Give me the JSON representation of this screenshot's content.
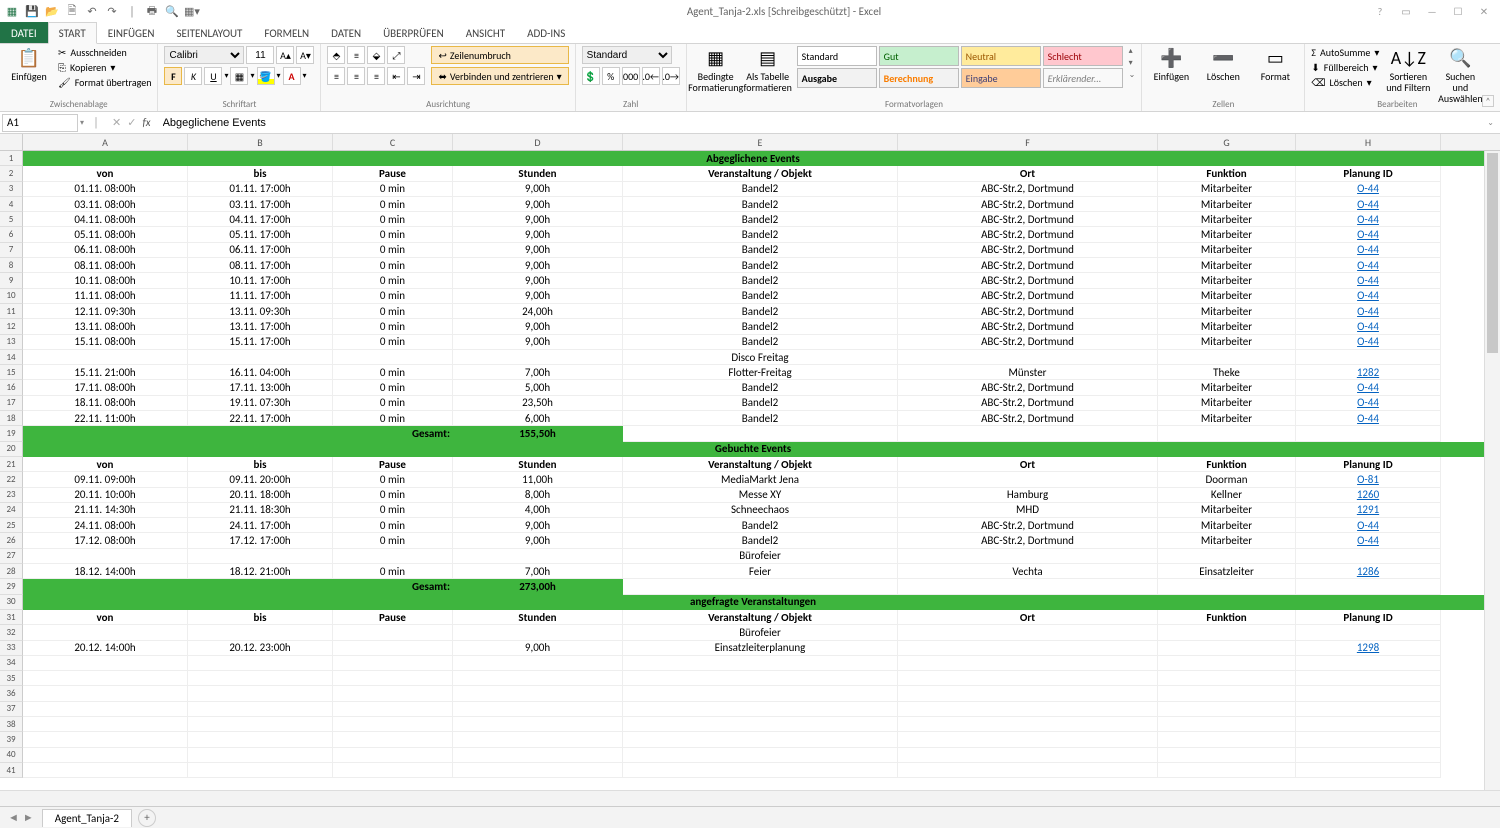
{
  "window": {
    "title": "Agent_Tanja-2.xls  [Schreibgeschützt] - Excel"
  },
  "qat": [
    "💾",
    "📂",
    "📄",
    "↶",
    "↷",
    "|",
    "🖨",
    "🔍",
    "⚙"
  ],
  "winbtns": {
    "help": "?",
    "opts": "▭",
    "min": "—",
    "max": "☐",
    "close": "✕"
  },
  "tabs": {
    "file": "DATEI",
    "start": "START",
    "einf": "EINFÜGEN",
    "layout": "SEITENLAYOUT",
    "form": "FORMELN",
    "daten": "DATEN",
    "ueber": "ÜBERPRÜFEN",
    "ans": "ANSICHT",
    "add": "ADD-INS"
  },
  "ribbon": {
    "clipboard": {
      "label": "Zwischenablage",
      "paste": "Einfügen",
      "cut": "Ausschneiden",
      "copy": "Kopieren",
      "format": "Format übertragen"
    },
    "font": {
      "label": "Schriftart",
      "name": "Calibri",
      "size": "11"
    },
    "align": {
      "label": "Ausrichtung",
      "wrap": "Zeilenumbruch",
      "merge": "Verbinden und zentrieren"
    },
    "number": {
      "label": "Zahl",
      "format": "Standard"
    },
    "styles": {
      "label": "Formatvorlagen",
      "cond": "Bedingte Formatierung",
      "table": "Als Tabelle formatieren",
      "standard": "Standard",
      "gut": "Gut",
      "neutral": "Neutral",
      "schlecht": "Schlecht",
      "ausgabe": "Ausgabe",
      "berechnung": "Berechnung",
      "eingabe": "Eingabe",
      "erkl": "Erklärender..."
    },
    "cells": {
      "label": "Zellen",
      "ins": "Einfügen",
      "del": "Löschen",
      "fmt": "Format"
    },
    "edit": {
      "label": "Bearbeiten",
      "sum": "AutoSumme",
      "fill": "Füllbereich",
      "clear": "Löschen",
      "sort": "Sortieren und Filtern",
      "find": "Suchen und Auswählen"
    }
  },
  "formulabar": {
    "cellref": "A1",
    "formula": "Abgeglichene Events"
  },
  "columns": [
    "A",
    "B",
    "C",
    "D",
    "E",
    "F",
    "G",
    "H"
  ],
  "sheet": {
    "tabname": "Agent_Tanja-2",
    "sections": [
      {
        "title": "Abgeglichene Events",
        "rows": [
          [
            "01.11. 08:00h",
            "01.11. 17:00h",
            "0 min",
            "9,00h",
            "Bandel2",
            "ABC-Str.2, Dortmund",
            "Mitarbeiter",
            "O-44"
          ],
          [
            "03.11. 08:00h",
            "03.11. 17:00h",
            "0 min",
            "9,00h",
            "Bandel2",
            "ABC-Str.2, Dortmund",
            "Mitarbeiter",
            "O-44"
          ],
          [
            "04.11. 08:00h",
            "04.11. 17:00h",
            "0 min",
            "9,00h",
            "Bandel2",
            "ABC-Str.2, Dortmund",
            "Mitarbeiter",
            "O-44"
          ],
          [
            "05.11. 08:00h",
            "05.11. 17:00h",
            "0 min",
            "9,00h",
            "Bandel2",
            "ABC-Str.2, Dortmund",
            "Mitarbeiter",
            "O-44"
          ],
          [
            "06.11. 08:00h",
            "06.11. 17:00h",
            "0 min",
            "9,00h",
            "Bandel2",
            "ABC-Str.2, Dortmund",
            "Mitarbeiter",
            "O-44"
          ],
          [
            "08.11. 08:00h",
            "08.11. 17:00h",
            "0 min",
            "9,00h",
            "Bandel2",
            "ABC-Str.2, Dortmund",
            "Mitarbeiter",
            "O-44"
          ],
          [
            "10.11. 08:00h",
            "10.11. 17:00h",
            "0 min",
            "9,00h",
            "Bandel2",
            "ABC-Str.2, Dortmund",
            "Mitarbeiter",
            "O-44"
          ],
          [
            "11.11. 08:00h",
            "11.11. 17:00h",
            "0 min",
            "9,00h",
            "Bandel2",
            "ABC-Str.2, Dortmund",
            "Mitarbeiter",
            "O-44"
          ],
          [
            "12.11. 09:30h",
            "13.11. 09:30h",
            "0 min",
            "24,00h",
            "Bandel2",
            "ABC-Str.2, Dortmund",
            "Mitarbeiter",
            "O-44"
          ],
          [
            "13.11. 08:00h",
            "13.11. 17:00h",
            "0 min",
            "9,00h",
            "Bandel2",
            "ABC-Str.2, Dortmund",
            "Mitarbeiter",
            "O-44"
          ],
          [
            "15.11. 08:00h",
            "15.11. 17:00h",
            "0 min",
            "9,00h",
            "Bandel2",
            "ABC-Str.2, Dortmund",
            "Mitarbeiter",
            "O-44"
          ],
          [
            "",
            "",
            "",
            "",
            "Disco Freitag",
            "",
            "",
            ""
          ],
          [
            "15.11. 21:00h",
            "16.11. 04:00h",
            "0 min",
            "7,00h",
            "Flotter-Freitag",
            "Münster",
            "Theke",
            "1282"
          ],
          [
            "17.11. 08:00h",
            "17.11. 13:00h",
            "0 min",
            "5,00h",
            "Bandel2",
            "ABC-Str.2, Dortmund",
            "Mitarbeiter",
            "O-44"
          ],
          [
            "18.11. 08:00h",
            "19.11. 07:30h",
            "0 min",
            "23,50h",
            "Bandel2",
            "ABC-Str.2, Dortmund",
            "Mitarbeiter",
            "O-44"
          ],
          [
            "22.11. 11:00h",
            "22.11. 17:00h",
            "0 min",
            "6,00h",
            "Bandel2",
            "ABC-Str.2, Dortmund",
            "Mitarbeiter",
            "O-44"
          ]
        ],
        "total_label": "Gesamt:",
        "total": "155,50h"
      },
      {
        "title": "Gebuchte Events",
        "rows": [
          [
            "09.11. 09:00h",
            "09.11. 20:00h",
            "0 min",
            "11,00h",
            "MediaMarkt Jena",
            "",
            "Doorman",
            "O-81"
          ],
          [
            "20.11. 10:00h",
            "20.11. 18:00h",
            "0 min",
            "8,00h",
            "Messe XY",
            "Hamburg",
            "Kellner",
            "1260"
          ],
          [
            "21.11. 14:30h",
            "21.11. 18:30h",
            "0 min",
            "4,00h",
            "Schneechaos",
            "MHD",
            "Mitarbeiter",
            "1291"
          ],
          [
            "24.11. 08:00h",
            "24.11. 17:00h",
            "0 min",
            "9,00h",
            "Bandel2",
            "ABC-Str.2, Dortmund",
            "Mitarbeiter",
            "O-44"
          ],
          [
            "17.12. 08:00h",
            "17.12. 17:00h",
            "0 min",
            "9,00h",
            "Bandel2",
            "ABC-Str.2, Dortmund",
            "Mitarbeiter",
            "O-44"
          ],
          [
            "",
            "",
            "",
            "",
            "Bürofeier",
            "",
            "",
            ""
          ],
          [
            "18.12. 14:00h",
            "18.12. 21:00h",
            "0 min",
            "7,00h",
            "Feier",
            "Vechta",
            "Einsatzleiter",
            "1286"
          ]
        ],
        "total_label": "Gesamt:",
        "total": "273,00h"
      },
      {
        "title": "angefragte Veranstaltungen",
        "rows": [
          [
            "",
            "",
            "",
            "",
            "Bürofeier",
            "",
            "",
            ""
          ],
          [
            "20.12. 14:00h",
            "20.12. 23:00h",
            "",
            "9,00h",
            "Einsatzleiterplanung",
            "",
            "",
            "1298"
          ]
        ]
      }
    ],
    "headers": [
      "von",
      "bis",
      "Pause",
      "Stunden",
      "Veranstaltung / Objekt",
      "Ort",
      "Funktion",
      "Planung ID"
    ]
  }
}
